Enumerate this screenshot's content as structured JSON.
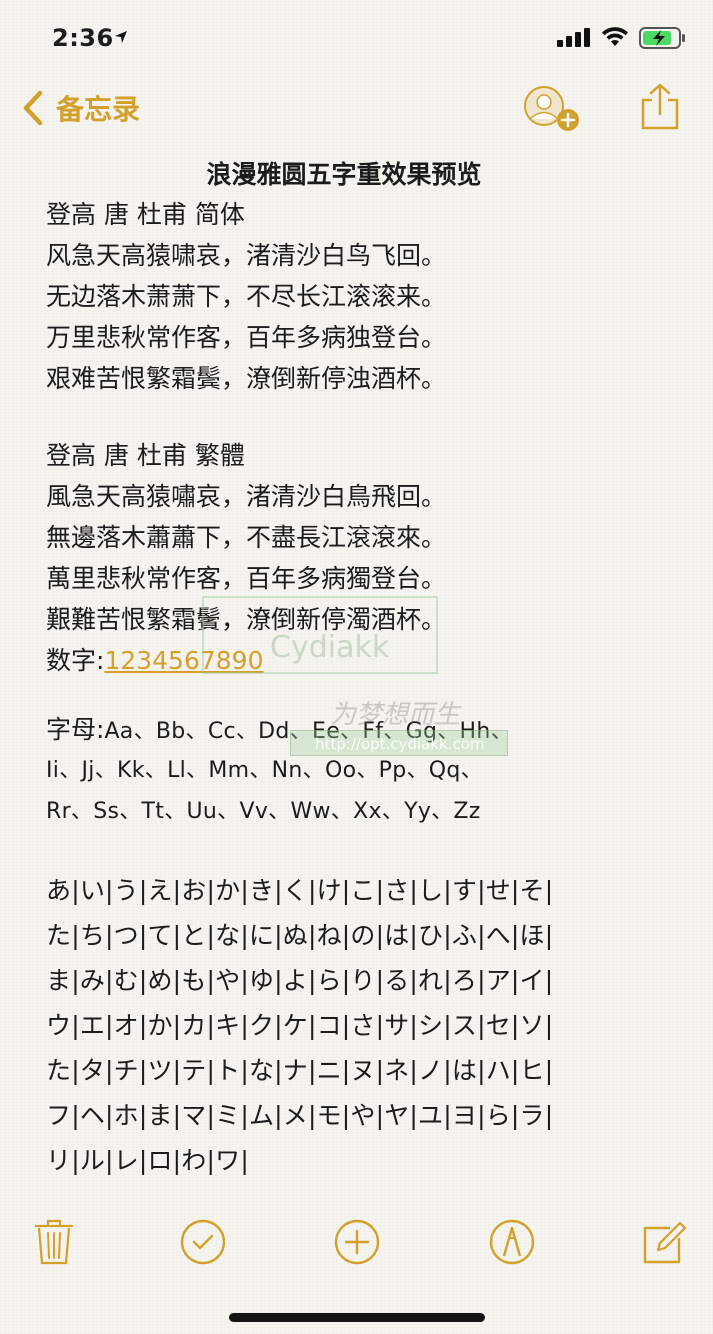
{
  "status_bar": {
    "time": "2:36"
  },
  "nav": {
    "back_label": "备忘录"
  },
  "note": {
    "title": "浪漫雅圆五字重效果预览",
    "lines_a": [
      "登高 唐 杜甫 简体",
      "风急天高猿啸哀，渚清沙白鸟飞回。",
      "无边落木萧萧下，不尽长江滚滚来。",
      "万里悲秋常作客，百年多病独登台。",
      "艰难苦恨繁霜鬓，潦倒新停浊酒杯。"
    ],
    "lines_b": [
      "登高 唐 杜甫 繁體",
      "風急天高猿嘯哀，渚清沙白鳥飛回。",
      "無邊落木蕭蕭下，不盡長江滾滾來。",
      "萬里悲秋常作客，百年多病獨登台。",
      "艱難苦恨繁霜鬢，潦倒新停濁酒杯。"
    ],
    "numbers_label": "数字:",
    "numbers_link": "1234567890",
    "letters_label": "字母:",
    "letters_lines": [
      "Aa、Bb、Cc、Dd、Ee、Ff、Gg、Hh、",
      "Ii、Jj、Kk、Ll、Mm、Nn、Oo、Pp、Qq、",
      "Rr、Ss、Tt、Uu、Vv、Ww、Xx、Yy、Zz"
    ],
    "kana_lines": [
      "あ|い|う|え|お|か|き|く|け|こ|さ|し|す|せ|そ|",
      "た|ち|つ|て|と|な|に|ぬ|ね|の|は|ひ|ふ|へ|ほ|",
      "ま|み|む|め|も|や|ゆ|よ|ら|り|る|れ|ろ|ア|イ|",
      "ウ|エ|オ|か|カ|キ|ク|ケ|コ|さ|サ|シ|ス|セ|ソ|",
      "た|タ|チ|ツ|テ|ト|な|ナ|ニ|ヌ|ネ|ノ|は|ハ|ヒ|",
      "フ|ヘ|ホ|ま|マ|ミ|ム|メ|モ|や|ヤ|ユ|ヨ|ら|ラ|",
      "リ|ル|レ|ロ|わ|ワ|"
    ]
  },
  "watermark": {
    "brand": "Cydiakk",
    "motto": "为梦想而生",
    "url": "http://opt.cydiakk.com"
  },
  "icons": {
    "back": "chevron-left-icon",
    "add_person": "add-person-icon",
    "share": "share-icon",
    "trash": "trash-icon",
    "checklist": "checkmark-circle-icon",
    "add": "plus-circle-icon",
    "markup": "markup-pen-icon",
    "compose": "compose-icon"
  },
  "colors": {
    "accent": "#d3a02c",
    "text": "#1c1c1c",
    "paper": "#f6f4ef"
  }
}
